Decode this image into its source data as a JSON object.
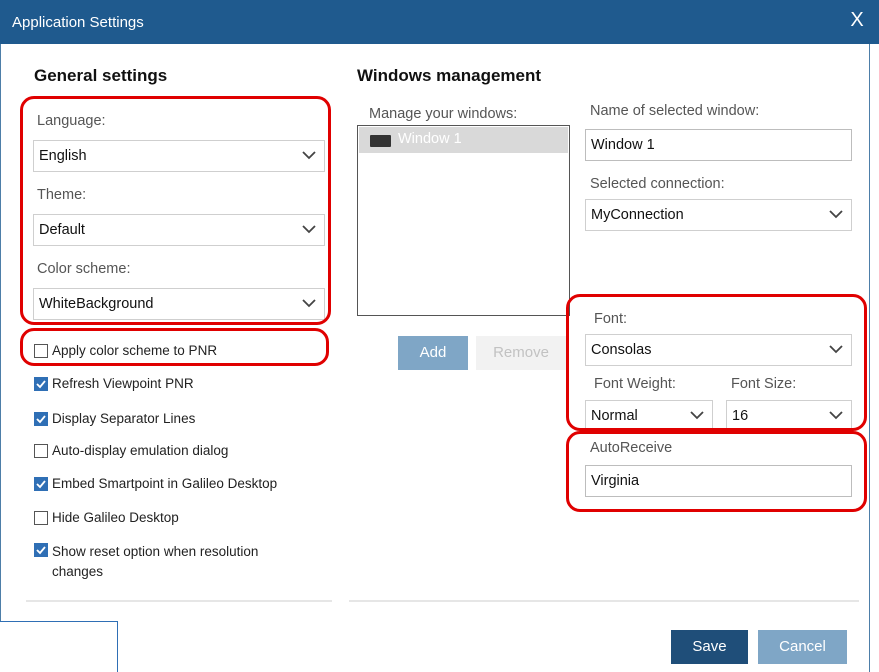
{
  "window": {
    "title": "Application Settings",
    "close_glyph": "X"
  },
  "general": {
    "heading": "General settings",
    "language": {
      "label": "Language:",
      "value": "English"
    },
    "theme": {
      "label": "Theme:",
      "value": "Default"
    },
    "color_scheme": {
      "label": "Color scheme:",
      "value": "WhiteBackground"
    },
    "checkboxes": [
      {
        "label": "Apply color scheme to PNR",
        "checked": false
      },
      {
        "label": "Refresh Viewpoint PNR",
        "checked": true
      },
      {
        "label": "Display Separator Lines",
        "checked": true
      },
      {
        "label": "Auto-display emulation dialog",
        "checked": false
      },
      {
        "label": "Embed Smartpoint in Galileo Desktop",
        "checked": true
      },
      {
        "label": "Hide Galileo Desktop",
        "checked": false
      },
      {
        "label": "Show reset option when resolution changes",
        "checked": true
      }
    ]
  },
  "windows": {
    "heading": "Windows management",
    "manage_label": "Manage your windows:",
    "list": [
      "Window 1"
    ],
    "add_label": "Add",
    "remove_label": "Remove",
    "name_label": "Name of selected window:",
    "name_value": "Window 1",
    "connection_label": "Selected connection:",
    "connection_value": "MyConnection",
    "font_label": "Font:",
    "font_value": "Consolas",
    "font_weight_label": "Font Weight:",
    "font_weight_value": "Normal",
    "font_size_label": "Font Size:",
    "font_size_value": "16",
    "autoreceive_label": "AutoReceive",
    "autoreceive_value": "Virginia"
  },
  "footer": {
    "save_label": "Save",
    "cancel_label": "Cancel"
  },
  "colors": {
    "titlebar": "#1f5a8e",
    "primary_button": "#1f4e79",
    "secondary_button": "#7fa6c6",
    "highlight": "#e00000"
  }
}
